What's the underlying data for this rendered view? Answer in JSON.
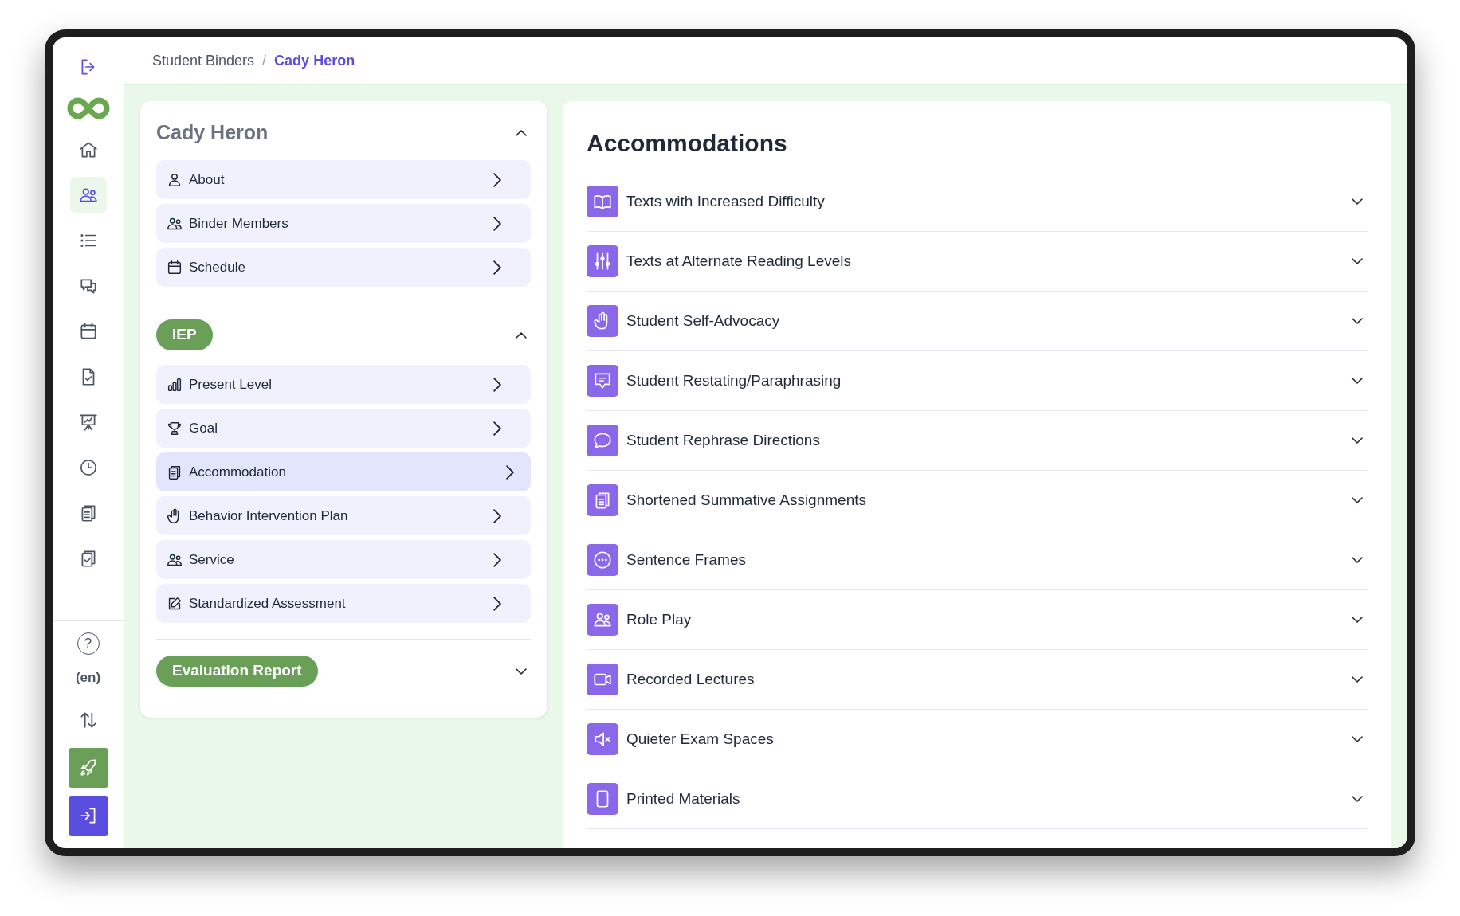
{
  "sidebar": {
    "nav_items": [
      {
        "selected": false
      },
      {
        "selected": true
      },
      {
        "selected": false
      },
      {
        "selected": false
      },
      {
        "selected": false
      },
      {
        "selected": false
      },
      {
        "selected": false
      },
      {
        "selected": false
      },
      {
        "selected": false
      },
      {
        "selected": false
      }
    ],
    "help": "?",
    "language": "(en)",
    "bottom_buttons": [
      {
        "kind": "plain"
      },
      {
        "kind": "green"
      },
      {
        "kind": "purple"
      }
    ]
  },
  "breadcrumb": {
    "separator": "/",
    "items": [
      {
        "label": "Student Binders",
        "current": false
      },
      {
        "label": "Cady Heron",
        "current": true
      }
    ]
  },
  "binder": {
    "title": "Cady Heron",
    "expanded": true,
    "items": [
      {
        "label": "About",
        "selected": false
      },
      {
        "label": "Binder Members",
        "selected": false
      },
      {
        "label": "Schedule",
        "selected": false
      }
    ],
    "sections": [
      {
        "label": "IEP",
        "expanded": true,
        "items": [
          {
            "label": "Present Level",
            "selected": false
          },
          {
            "label": "Goal",
            "selected": false
          },
          {
            "label": "Accommodation",
            "selected": true
          },
          {
            "label": "Behavior Intervention Plan",
            "selected": false
          },
          {
            "label": "Service",
            "selected": false
          },
          {
            "label": "Standardized Assessment",
            "selected": false
          }
        ]
      },
      {
        "label": "Evaluation Report",
        "expanded": false
      }
    ]
  },
  "accommodations": {
    "title": "Accommodations",
    "items": [
      {
        "label": "Texts with Increased Difficulty",
        "expanded": false
      },
      {
        "label": "Texts at Alternate Reading Levels",
        "expanded": false
      },
      {
        "label": "Student Self-Advocacy",
        "expanded": false
      },
      {
        "label": "Student Restating/Paraphrasing",
        "expanded": false
      },
      {
        "label": "Student Rephrase Directions",
        "expanded": false
      },
      {
        "label": "Shortened Summative Assignments",
        "expanded": false
      },
      {
        "label": "Sentence Frames",
        "expanded": false
      },
      {
        "label": "Role Play",
        "expanded": false
      },
      {
        "label": "Recorded Lectures",
        "expanded": false
      },
      {
        "label": "Quieter Exam Spaces",
        "expanded": false
      },
      {
        "label": "Printed Materials",
        "expanded": false
      }
    ]
  }
}
